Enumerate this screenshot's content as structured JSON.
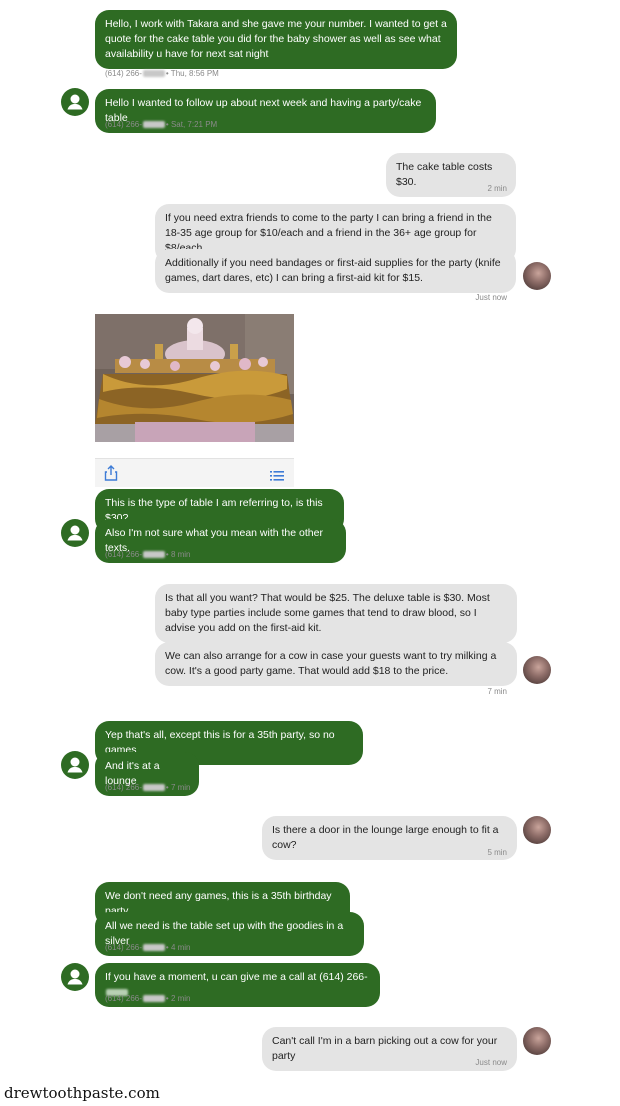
{
  "contact_number": "(614) 266-",
  "messages": [
    {
      "text": "Hello, I work with Takara and she gave me your number. I wanted to get a quote for the cake table you did for the baby shower as well as see what availability u have for next sat night"
    },
    {
      "text": "Hello I wanted to follow up about next week and having a party/cake table"
    },
    {
      "text": "The cake table costs $30."
    },
    {
      "text": "If you need extra friends to come to the party I can bring a friend in the 18-35 age group for $10/each and a friend in the 36+ age group for $8/each."
    },
    {
      "text": "Additionally if you need bandages or first-aid supplies for the party (knife games, dart dares, etc) I can bring a first-aid kit for $15."
    },
    {
      "text": "This is the type of table I am referring to, is this $30?"
    },
    {
      "text": "Also I'm not sure what you mean with the other texts."
    },
    {
      "text": "Is that all you want? That would be $25. The deluxe table is $30. Most baby type parties include some games that tend to draw blood, so I advise you add on the first-aid kit."
    },
    {
      "text": "We can also arrange for a cow in case your guests want to try milking a cow. It's a good party game. That would add $18 to the price."
    },
    {
      "text": "Yep that's all, except this is for a 35th party, so no games"
    },
    {
      "text": "And it's at a lounge"
    },
    {
      "text": "Is there a door in the lounge large enough to fit a cow?"
    },
    {
      "text": "We don't need any games, this is a 35th birthday party"
    },
    {
      "text": "All we need is the table set up with the goodies in a silver"
    },
    {
      "text": "If you have a moment, u can give me a call at (614) 266-"
    },
    {
      "text": "Can't call I'm in a barn picking out a cow for your party"
    }
  ],
  "timestamps": {
    "t1": "• Thu, 8:56 PM",
    "t2": "• Sat, 7:21 PM",
    "t3": "2 min",
    "t4": "Just now",
    "t5": "• 8 min",
    "t6": "7 min",
    "t7": "• 7 min",
    "t8": "5 min",
    "t9": "• 4 min",
    "t10": "• 2 min",
    "t11": "Just now"
  },
  "icons": {
    "share": "share-icon",
    "list": "list-icon",
    "contact": "person-icon"
  },
  "colors": {
    "incoming_bubble": "#2e6b23",
    "outgoing_bubble": "#e4e4e4",
    "meta_text": "#8a8a8a"
  },
  "watermark": "drewtoothpaste.com"
}
